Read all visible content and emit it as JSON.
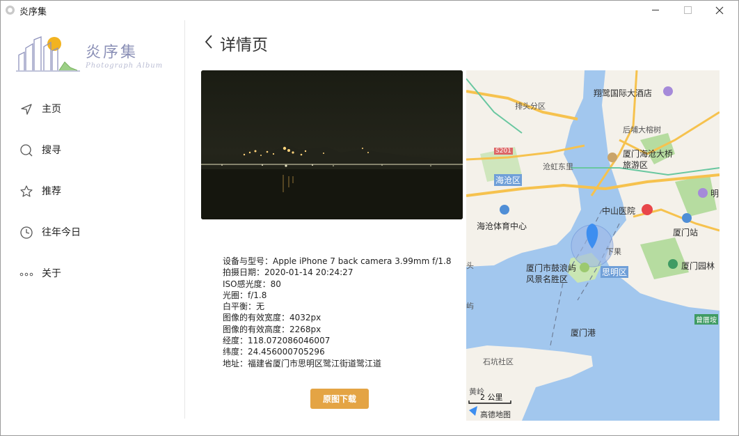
{
  "window": {
    "title": "炎序集"
  },
  "logo": {
    "title": "炎序集",
    "subtitle": "Photograph Album"
  },
  "sidebar": {
    "items": [
      {
        "label": "主页",
        "icon": "navigation-arrow-icon"
      },
      {
        "label": "搜寻",
        "icon": "search-icon"
      },
      {
        "label": "推荐",
        "icon": "star-icon"
      },
      {
        "label": "往年今日",
        "icon": "clock-icon"
      },
      {
        "label": "关于",
        "icon": "more-dots-icon"
      }
    ]
  },
  "header": {
    "title": "详情页"
  },
  "details": {
    "rows": [
      "设备与型号：Apple iPhone 7 back camera 3.99mm f/1.8",
      "拍摄日期：2020-01-14 20:24:27",
      "ISO感光度：80",
      "光圈：f/1.8",
      "白平衡：无",
      "图像的有效宽度：4032px",
      "图像的有效高度：2268px",
      "经度：118.072086046007",
      "纬度：24.456000705296",
      "地址：福建省厦门市思明区鹭江街道鹭江道"
    ]
  },
  "download": {
    "label": "原图下载"
  },
  "map": {
    "labels": [
      "翔鹭国际大酒店",
      "排头分区",
      "后埔大榕树",
      "S201",
      "厦门海沧大桥旅游区",
      "海沧区",
      "沧虹东里",
      "明",
      "中山医院",
      "海沧体育中心",
      "厦门站",
      "下果",
      "厦门市鼓浪屿风景名胜区",
      "思明区",
      "厦门园林",
      "头",
      "屿",
      "曾厝垵",
      "厦门港",
      "石坑社区",
      "黄岭",
      "2 公里",
      "高德地图"
    ],
    "colors": {
      "water": "#a2c7ee",
      "land": "#f5f3ee",
      "green": "#b6dca0",
      "road": "#f6c24e",
      "marker": "#3d8ef0"
    }
  },
  "colors": {
    "accent": "#e4a444",
    "logo": "#8a8fb6"
  }
}
